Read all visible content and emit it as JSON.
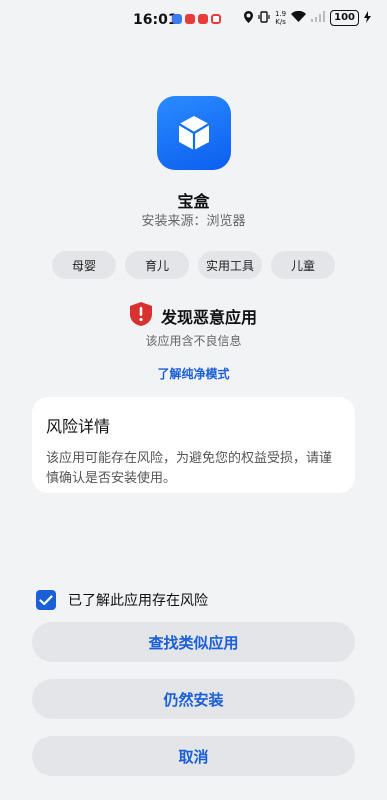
{
  "status_bar": {
    "time": "16:01",
    "net_speed_top": "1.9",
    "net_speed_bottom": "K/s",
    "battery": "100",
    "notif_colors": [
      "#3b7cf0",
      "#e83c3c",
      "#e83c3c",
      "#e83c3c"
    ]
  },
  "app": {
    "name": "宝盒",
    "source": "安装来源：浏览器",
    "icon": "box-icon",
    "icon_colors": [
      "#2a8cff",
      "#0c5ef0"
    ]
  },
  "tags": [
    "母婴",
    "育儿",
    "实用工具",
    "儿童"
  ],
  "warning": {
    "title": "发现恶意应用",
    "subtitle": "该应用含不良信息",
    "link": "了解纯净模式",
    "icon": "shield-alert-icon",
    "color": "#d93030"
  },
  "risk": {
    "title": "风险详情",
    "body": "该应用可能存在风险，为避免您的权益受损，请谨慎确认是否安装使用。"
  },
  "consent": {
    "label": "已了解此应用存在风险",
    "checked": true
  },
  "buttons": {
    "similar": "查找类似应用",
    "install": "仍然安装",
    "cancel": "取消"
  },
  "accent": "#1a5fd6"
}
